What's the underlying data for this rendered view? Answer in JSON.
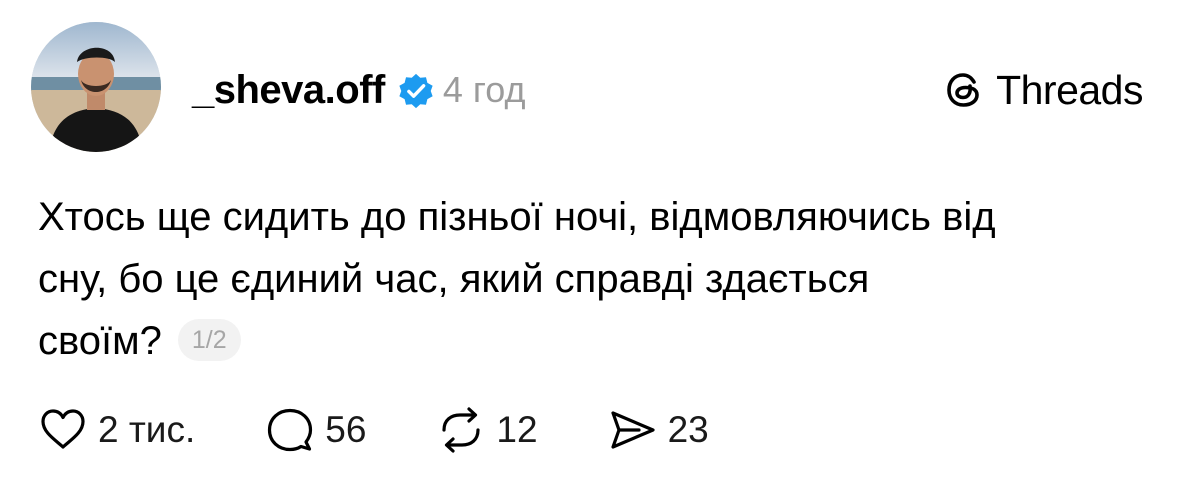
{
  "post": {
    "username": "_sheva.off",
    "time": "4 год",
    "text_lines": [
      "Хтось ще сидить до пізньої ночі, відмовляючись від",
      "сну, бо це єдиний час, який справді здається",
      "своїм?"
    ],
    "pager": "1/2"
  },
  "brand": {
    "name": "Threads",
    "icon": "threads-logo-icon"
  },
  "actions": {
    "like_count": "2 тис.",
    "reply_count": "56",
    "repost_count": "12",
    "share_count": "23"
  },
  "colors": {
    "verified": "#1d9bf0",
    "muted": "#9b9b9b",
    "text": "#000000"
  }
}
